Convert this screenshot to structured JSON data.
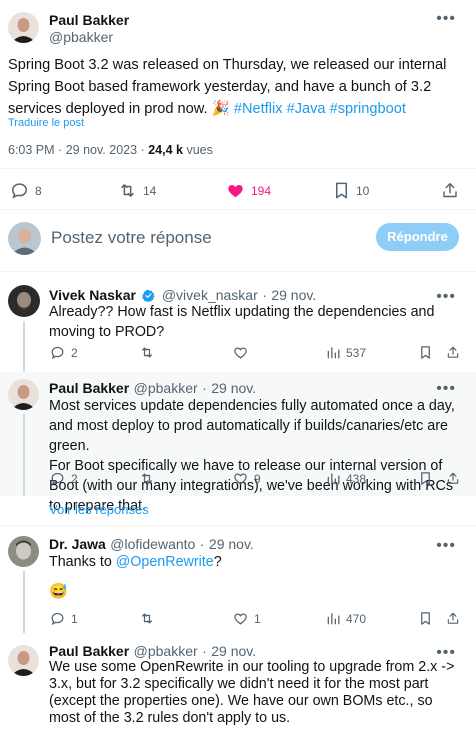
{
  "main_tweet": {
    "author_name": "Paul Bakker",
    "author_handle": "@pbakker",
    "text_plain": "Spring Boot 3.2 was released on Thursday, we released our internal Spring Boot based framework yesterday, and have a bunch of 3.2 services deployed in prod now. ",
    "emoji": "🎉",
    "hashtags": [
      "#Netflix",
      "#Java",
      "#springboot"
    ],
    "translate_label": "Traduire le post",
    "time": "6:03 PM",
    "date": "29 nov. 2023",
    "views_count": "24,4 k",
    "views_label": "vues",
    "stats": {
      "replies": "8",
      "retweets": "14",
      "likes": "194",
      "bookmarks": "10"
    }
  },
  "compose": {
    "placeholder": "Postez votre réponse",
    "button_label": "Répondre"
  },
  "replies": [
    {
      "author_name": "Vivek Naskar",
      "verified": true,
      "author_handle": "@vivek_naskar",
      "date": "29 nov.",
      "text": "Already?? How fast is Netflix updating the dependencies and moving to PROD?",
      "stats": {
        "replies": "2",
        "retweets": "",
        "likes": "",
        "views": "537"
      }
    },
    {
      "author_name": "Paul Bakker",
      "author_handle": "@pbakker",
      "date": "29 nov.",
      "text": "Most services update dependencies fully automated once a day, and most deploy to prod automatically if builds/canaries/etc are green.\nFor Boot specifically we have to release our internal version of Boot (with our many integrations), we've been working with RCs to prepare that.",
      "stats": {
        "replies": "2",
        "retweets": "",
        "likes": "9",
        "views": "438"
      },
      "show_replies_label": "Voir les réponses"
    },
    {
      "author_name": "Dr. Jawa",
      "author_handle": "@lofidewanto",
      "date": "29 nov.",
      "text_prefix": "Thanks to ",
      "mention": "@OpenRewrite",
      "text_suffix": "?",
      "emoji": "😅",
      "stats": {
        "replies": "1",
        "retweets": "",
        "likes": "1",
        "views": "470"
      }
    },
    {
      "author_name": "Paul Bakker",
      "author_handle": "@pbakker",
      "date": "29 nov.",
      "text": "We use some OpenRewrite in our tooling to upgrade from 2.x -> 3.x, but for 3.2 specifically we didn't need it for the most part (except the properties one). We have our own BOMs etc., so most of the 3.2 rules don't apply to us."
    }
  ],
  "separator": "·",
  "colors": {
    "text": "#0f1419",
    "muted": "#536471",
    "link": "#1d9bf0",
    "like": "#f91880",
    "reply_button": "#8ecdf8",
    "divider": "#eff3f4",
    "thread_line": "#cfd9de",
    "verified": "#1d9bf0"
  },
  "icons": [
    "more-icon",
    "reply-icon",
    "retweet-icon",
    "heart-filled-icon",
    "heart-icon",
    "bookmark-icon",
    "share-icon",
    "views-icon",
    "verified-badge-icon"
  ]
}
